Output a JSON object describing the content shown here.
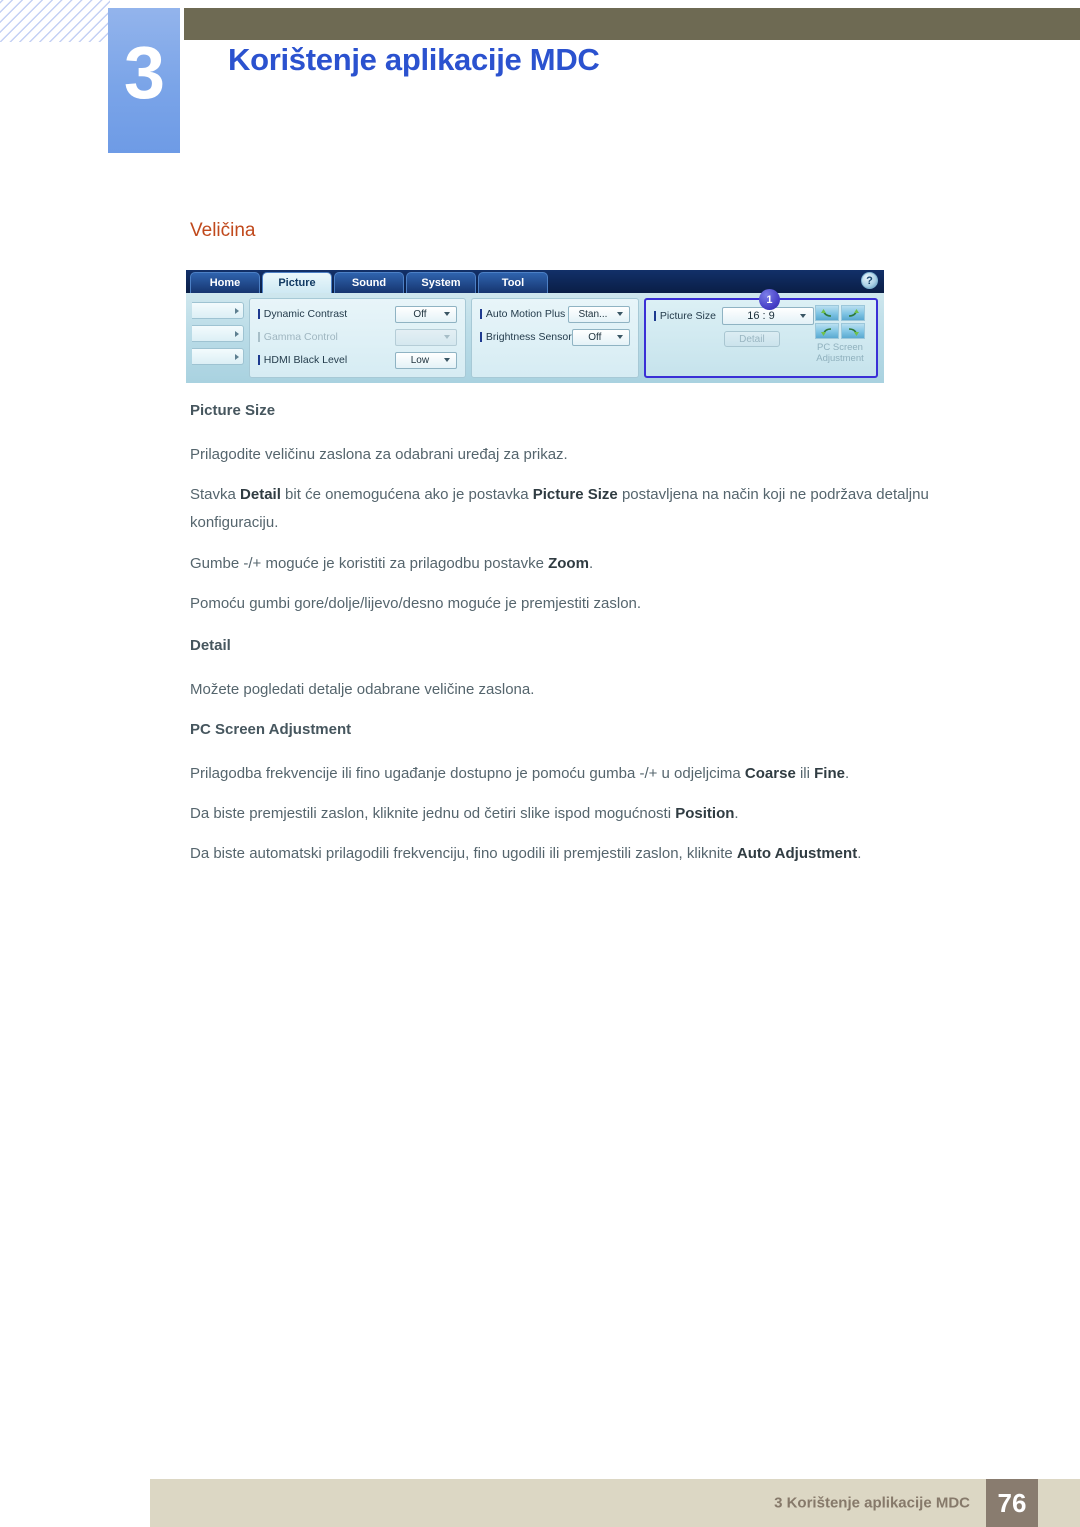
{
  "header": {
    "chapter_number": "3",
    "chapter_title": "Korištenje aplikacije MDC",
    "accent_color": "#2b52cf",
    "bar_color": "#6e6a53",
    "tab_color": "#7aa4e8"
  },
  "section": {
    "heading": "Veličina",
    "heading_color": "#c0491c"
  },
  "mdc": {
    "tabs": [
      {
        "label": "Home",
        "active": false
      },
      {
        "label": "Picture",
        "active": true
      },
      {
        "label": "Sound",
        "active": false
      },
      {
        "label": "System",
        "active": false
      },
      {
        "label": "Tool",
        "active": false
      }
    ],
    "help_icon": "question-mark-icon",
    "panel_one": [
      {
        "label": "Dynamic Contrast",
        "value": "Off",
        "disabled": false
      },
      {
        "label": "Gamma Control",
        "value": "",
        "disabled": true
      },
      {
        "label": "HDMI Black Level",
        "value": "Low",
        "disabled": false
      }
    ],
    "panel_two": [
      {
        "label": "Auto Motion Plus",
        "value": "Stan...",
        "disabled": false
      },
      {
        "label": "Brightness Sensor",
        "value": "Off",
        "disabled": false
      }
    ],
    "highlight": {
      "callout_badge": "1",
      "callout_color": "#3a2fd6",
      "picture_size_label": "Picture Size",
      "picture_size_value": "16 : 9",
      "detail_button": "Detail",
      "pc_screen_label_line1": "PC Screen",
      "pc_screen_label_line2": "Adjustment",
      "position_icon": "four-direction-arrows-grid-icon"
    }
  },
  "content": {
    "picture_size_heading": "Picture Size",
    "picture_size_p1": "Prilagodite veličinu zaslona za odabrani uređaj za prikaz.",
    "picture_size_p2_a": "Stavka ",
    "picture_size_p2_b": "Detail",
    "picture_size_p2_c": " bit će onemogućena ako je postavka ",
    "picture_size_p2_d": "Picture Size",
    "picture_size_p2_e": " postavljena na način koji ne podržava detaljnu konfiguraciju.",
    "picture_size_p3_a": "Gumbe -/+ moguće je koristiti za prilagodbu postavke ",
    "picture_size_p3_b": "Zoom",
    "picture_size_p3_c": ".",
    "picture_size_p4": "Pomoću gumbi gore/dolje/lijevo/desno moguće je premjestiti zaslon.",
    "detail_heading": "Detail",
    "detail_p1": "Možete pogledati detalje odabrane veličine zaslona.",
    "pcsa_heading": "PC Screen Adjustment",
    "pcsa_p1_a": "Prilagodba frekvencije ili fino ugađanje dostupno je pomoću gumba -/+ u odjeljcima ",
    "pcsa_p1_b": "Coarse",
    "pcsa_p1_c": " ili ",
    "pcsa_p1_d": "Fine",
    "pcsa_p1_e": ".",
    "pcsa_p2_a": "Da biste premjestili zaslon, kliknite jednu od četiri slike ispod mogućnosti ",
    "pcsa_p2_b": "Position",
    "pcsa_p2_c": ".",
    "pcsa_p3_a": "Da biste automatski prilagodili frekvenciju, fino ugodili ili premjestili zaslon, kliknite ",
    "pcsa_p3_b": "Auto Adjustment",
    "pcsa_p3_c": "."
  },
  "footer": {
    "text": "3 Korištenje aplikacije MDC",
    "page_number": "76",
    "bar_color": "#dcd7c4",
    "page_box_color": "#897c6f"
  }
}
